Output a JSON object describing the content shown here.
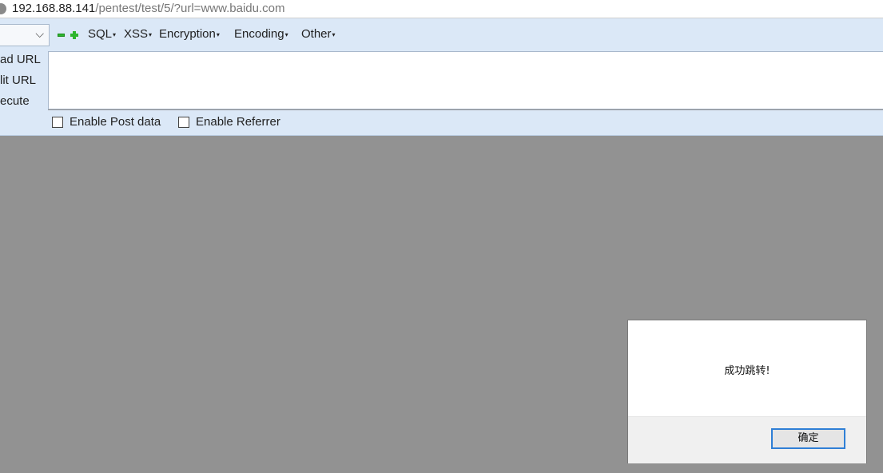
{
  "url_bar": {
    "host": "192.168.88.141",
    "path": "/pentest/test/5/?url=www.baidu.com"
  },
  "hackbar": {
    "menus": [
      "SQL",
      "XSS",
      "Encryption",
      "Encoding",
      "Other"
    ],
    "labels": {
      "load": "ad URL",
      "split": "lit URL",
      "execute": "ecute"
    },
    "options": {
      "post_data": "Enable Post data",
      "referrer": "Enable Referrer"
    }
  },
  "alert": {
    "message": "成功跳转!",
    "ok_label": "确定"
  },
  "colors": {
    "toolbar_bg": "#dbe8f7",
    "page_bg": "#929292",
    "ok_border": "#2f7fd6",
    "plus_minus_green": "#2db52d"
  },
  "icons": {
    "url_globe": "globe-icon",
    "select_chevron": "chevron-down-icon",
    "minus": "minus-icon",
    "plus": "plus-icon"
  }
}
